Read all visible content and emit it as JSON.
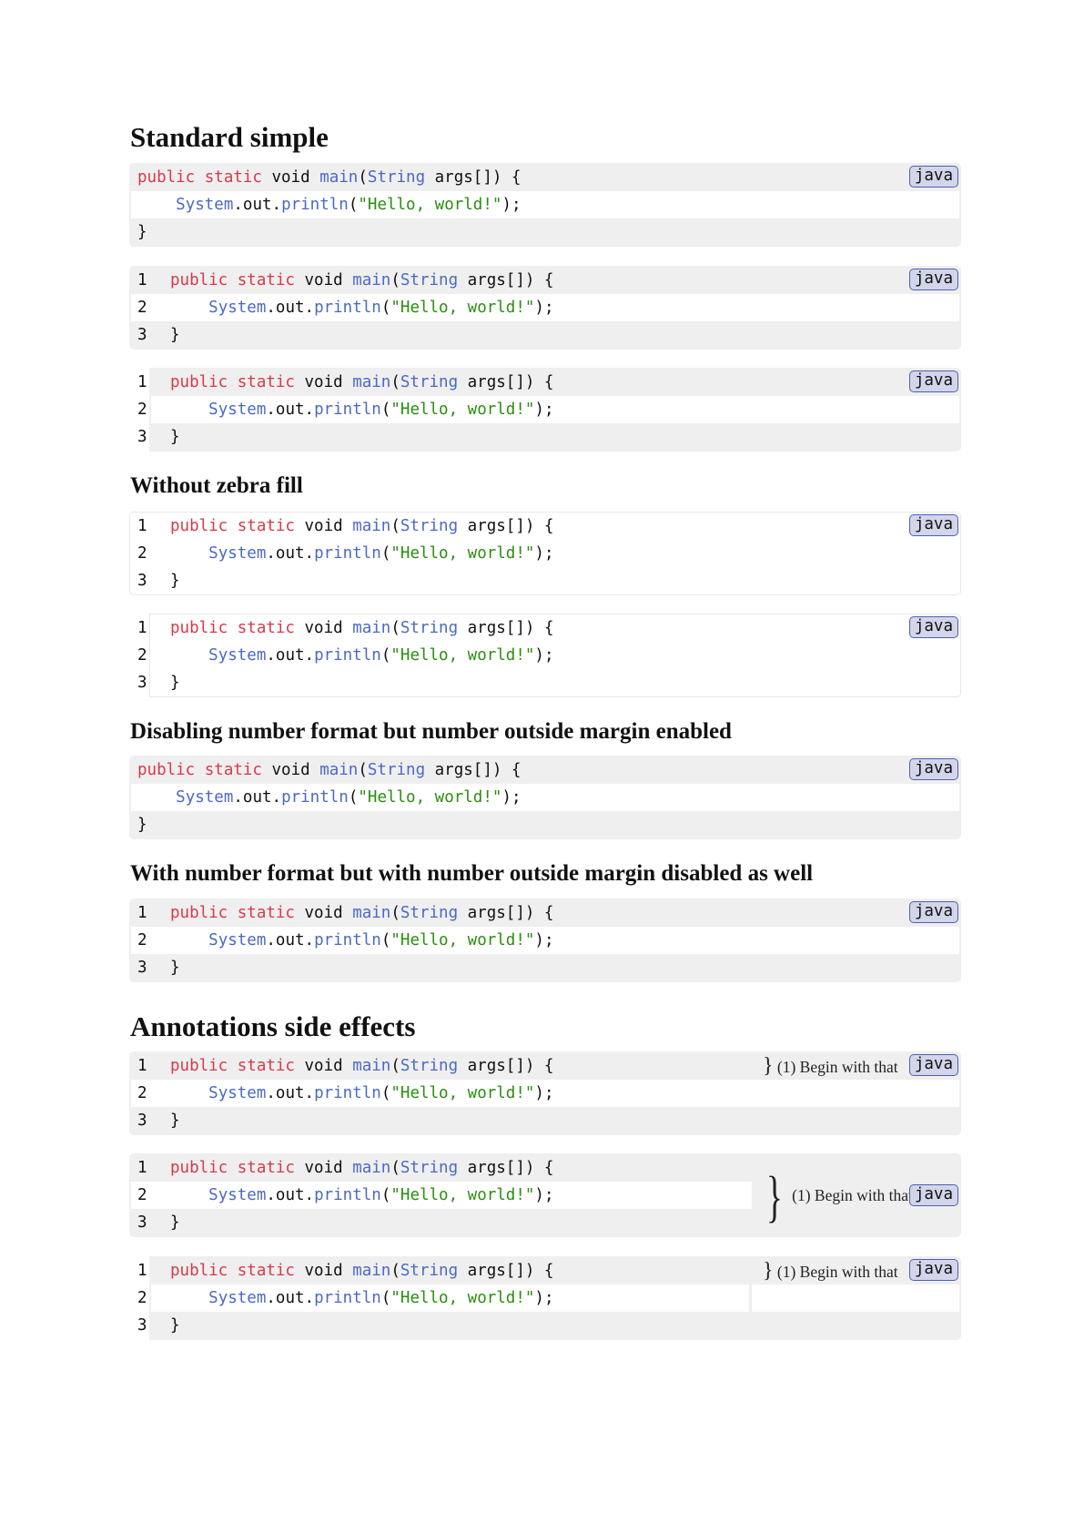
{
  "headings": [
    "Standard simple",
    "Without zebra fill",
    "Disabling number format but number outside margin enabled",
    "With number format but with number outside margin disabled as well",
    "Annotations side effects"
  ],
  "language_badge": "java",
  "colors": {
    "keyword": "#d73a49",
    "function": "#4b69c6",
    "string": "#298e0d",
    "zebra": "#efefef",
    "badge_bg": "#d3d6ea",
    "badge_border": "#4f5fb0"
  },
  "code_lines": [
    [
      {
        "t": "public static",
        "c": "kw"
      },
      {
        "t": " void ",
        "c": "pl"
      },
      {
        "t": "main",
        "c": "fn"
      },
      {
        "t": "(",
        "c": "pl"
      },
      {
        "t": "String",
        "c": "fn"
      },
      {
        "t": " args[]) {",
        "c": "pl"
      }
    ],
    [
      {
        "t": "    ",
        "c": "pl"
      },
      {
        "t": "System",
        "c": "fn"
      },
      {
        "t": ".out.",
        "c": "pl"
      },
      {
        "t": "println",
        "c": "fn"
      },
      {
        "t": "(",
        "c": "pl"
      },
      {
        "t": "\"Hello, world!\"",
        "c": "st"
      },
      {
        "t": ");",
        "c": "pl"
      }
    ],
    [
      {
        "t": "}",
        "c": "pl"
      }
    ]
  ],
  "line_numbers": [
    "1",
    "2",
    "3"
  ],
  "annotation": {
    "brace": "}",
    "text": "(1) Begin with that"
  },
  "blocks": [
    {
      "section": 0,
      "style": "zebra",
      "numbers": "none"
    },
    {
      "section": 0,
      "style": "zebra",
      "numbers": "inside"
    },
    {
      "section": 0,
      "style": "zebra",
      "numbers": "outside"
    },
    {
      "section": 1,
      "style": "plain",
      "numbers": "inside"
    },
    {
      "section": 1,
      "style": "plain",
      "numbers": "outside"
    },
    {
      "section": 2,
      "style": "zebra",
      "numbers": "none"
    },
    {
      "section": 3,
      "style": "zebra",
      "numbers": "inside"
    },
    {
      "section": 4,
      "style": "zebra",
      "numbers": "inside",
      "annotation": "line1"
    },
    {
      "section": 4,
      "style": "zebra",
      "numbers": "inside",
      "annotation": "span"
    },
    {
      "section": 4,
      "style": "zebra",
      "numbers": "outside",
      "annotation": "line1"
    }
  ]
}
